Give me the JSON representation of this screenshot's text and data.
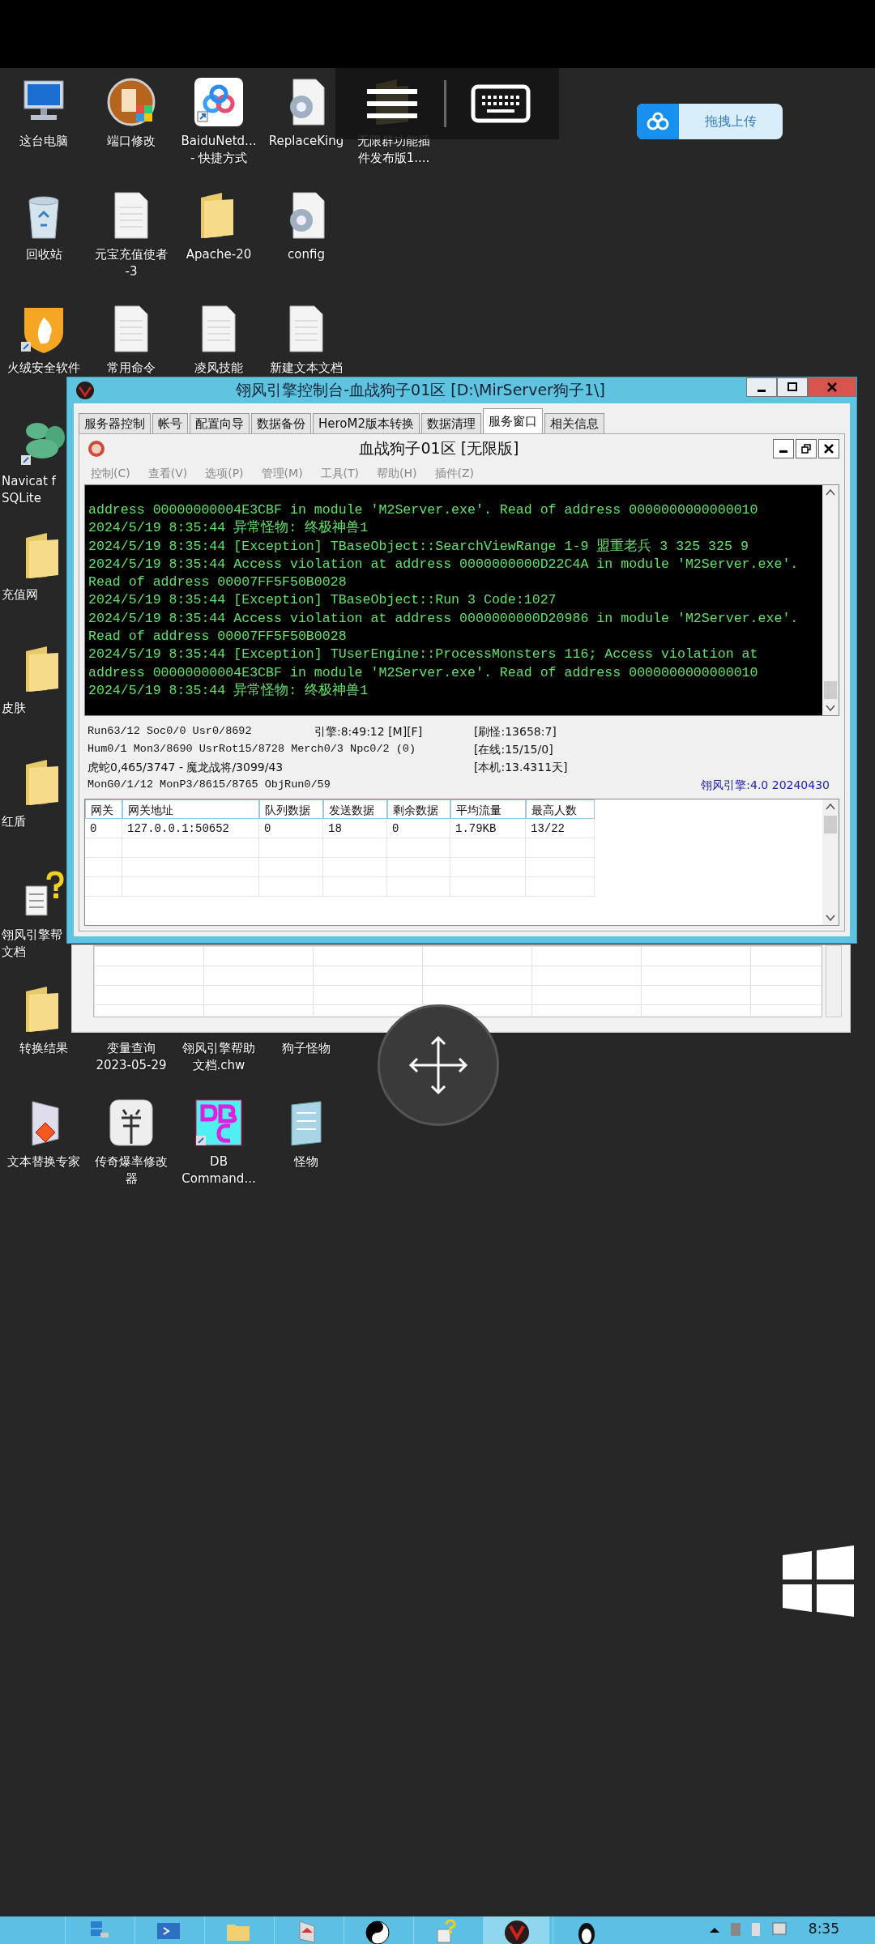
{
  "upload_button": {
    "label": "拖拽上传"
  },
  "desktop_icons": [
    {
      "label": "这台电脑",
      "kind": "computer"
    },
    {
      "label": "端口修改",
      "kind": "portapp"
    },
    {
      "label": "BaiduNetd...\n- 快捷方式",
      "kind": "cloud"
    },
    {
      "label": "ReplaceKing",
      "kind": "gear"
    },
    {
      "label": "无限群功能插件发布版1....",
      "kind": "folder"
    },
    {
      "label": "回收站",
      "kind": "recycle"
    },
    {
      "label": "元宝充值使者\n-3",
      "kind": "document"
    },
    {
      "label": "Apache-20",
      "kind": "folder"
    },
    {
      "label": "config",
      "kind": "gear"
    },
    {
      "label": "火绒安全软件",
      "kind": "shield"
    },
    {
      "label": "常用命令",
      "kind": "document"
    },
    {
      "label": "凌风技能",
      "kind": "document"
    },
    {
      "label": "新建文本文档",
      "kind": "document"
    },
    {
      "label": "Navicat f\nSQLite",
      "kind": "navicat"
    },
    {
      "label": "充值网",
      "kind": "folder"
    },
    {
      "label": "皮肤",
      "kind": "folder"
    },
    {
      "label": "红盾",
      "kind": "folder"
    },
    {
      "label": "翎风引擎帮文档",
      "kind": "helpdoc"
    },
    {
      "label": "转换结果",
      "kind": "folder"
    },
    {
      "label": "变量查询\n2023-05-29",
      "kind": "covered"
    },
    {
      "label": "翎风引擎帮助文档.chw",
      "kind": "covered"
    },
    {
      "label": "狗子怪物",
      "kind": "covered"
    },
    {
      "label": "文本替换专家",
      "kind": "installer"
    },
    {
      "label": "传奇爆率修改器",
      "kind": "sheep"
    },
    {
      "label": "DB\nCommand...",
      "kind": "dbc"
    },
    {
      "label": "怪物",
      "kind": "notepad"
    }
  ],
  "window": {
    "title": "翎风引擎控制台-血战狗子01区 [D:\\MirServer狗子1\\]",
    "tabs": [
      {
        "label": "服务器控制",
        "selected": false
      },
      {
        "label": "帐号",
        "selected": false
      },
      {
        "label": "配置向导",
        "selected": false
      },
      {
        "label": "数据备份",
        "selected": false
      },
      {
        "label": "HeroM2版本转换",
        "selected": false
      },
      {
        "label": "数据清理",
        "selected": false
      },
      {
        "label": "服务窗口",
        "selected": true
      },
      {
        "label": "相关信息",
        "selected": false
      }
    ],
    "child_window": {
      "title": "血战狗子01区 [无限版]",
      "menu": [
        "控制(C)",
        "查看(V)",
        "选项(P)",
        "管理(M)",
        "工具(T)",
        "帮助(H)",
        "插件(Z)"
      ],
      "log_lines": [
        "address 00000000004E3CBF in module 'M2Server.exe'. Read of address 0000000000000010",
        "2024/5/19 8:35:44 异常怪物: 终极神兽1",
        "2024/5/19 8:35:44 [Exception] TBaseObject::SearchViewRange 1-9 盟重老兵 3 325 325 9",
        "2024/5/19 8:35:44 Access violation at address 0000000000D22C4A in module 'M2Server.exe'.",
        "Read of address 00007FF5F50B0028",
        "2024/5/19 8:35:44 [Exception] TBaseObject::Run 3 Code:1027",
        "2024/5/19 8:35:44 Access violation at address 0000000000D20986 in module 'M2Server.exe'.",
        "Read of address 00007FF5F50B0028",
        "2024/5/19 8:35:44 [Exception] TUserEngine::ProcessMonsters 116; Access violation at",
        "address 00000000004E3CBF in module 'M2Server.exe'. Read of address 0000000000000010",
        "2024/5/19 8:35:44 异常怪物: 终极神兽1"
      ],
      "status": {
        "run": "Run63/12 Soc0/0 Usr0/8692",
        "engine_time": "引擎:8:49:12 [M][F]",
        "spawn": "[刷怪:13658:7]",
        "counts": "Hum0/1 Mon3/8690 UsrRot15/8728 Merch0/3 Npc0/2 (0)",
        "online": "[在线:15/15/0]",
        "boss": "虎蛇0,465/3747 - 魔龙战将/3099/43",
        "uptime": "[本机:13.4311天]",
        "objects": "MonG0/1/12 MonP3/8615/8765 ObjRun0/59",
        "version": "翎风引擎:4.0 20240430"
      },
      "gateway_table": {
        "columns": [
          "网关",
          "网关地址",
          "队列数据",
          "发送数据",
          "剩余数据",
          "平均流量",
          "最高人数"
        ],
        "rows": [
          [
            "0",
            "127.0.0.1:50652",
            "0",
            "18",
            "0",
            "1.79KB",
            "13/22"
          ]
        ]
      }
    }
  },
  "taskbar": {
    "clock": "8:35"
  }
}
